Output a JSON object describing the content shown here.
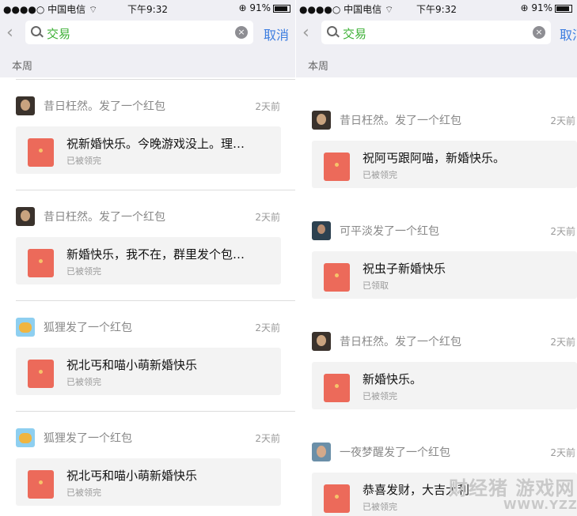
{
  "status_left": {
    "carrier": "●●●●○ 中国电信 ⌔",
    "time": "下午9:32",
    "battery": "⊕ 91%"
  },
  "status_right": {
    "carrier": "●●●●○ 中国电信 ⌔",
    "time": "下午9:32",
    "battery": "⊕ 91%"
  },
  "search": {
    "back_icon": "‹",
    "query": "交易",
    "clear_icon": "×",
    "cancel": "取消"
  },
  "section": "本周",
  "colors": {
    "accent": "#3c7de0",
    "query_green": "#3cb035",
    "envelope": "#ec6a5a",
    "bg_gray": "#efeff4"
  },
  "left_items": [
    {
      "name": "昔日枉然。发了一个红包",
      "date": "2天前",
      "wish": "祝新婚快乐。今晚游戏没上。理…",
      "status": "已被领完",
      "avatar": "man-avatar"
    },
    {
      "name": "昔日枉然。发了一个红包",
      "date": "2天前",
      "wish": "新婚快乐，我不在，群里发个包…",
      "status": "已被领完",
      "avatar": "man-avatar"
    },
    {
      "name": "狐狸发了一个红包",
      "date": "2天前",
      "wish": "祝北丐和喵小萌新婚快乐",
      "status": "已被领完",
      "avatar": "cartoon-avatar"
    },
    {
      "name": "狐狸发了一个红包",
      "date": "2天前",
      "wish": "祝北丐和喵小萌新婚快乐",
      "status": "已被领完",
      "avatar": "cartoon-avatar"
    }
  ],
  "right_items": [
    {
      "name": "昔日枉然。发了一个红包",
      "date": "2天前",
      "wish": "祝阿丐跟阿喵，新婚快乐。",
      "status": "已被领完",
      "avatar": "man-avatar"
    },
    {
      "name": "可平淡发了一个红包",
      "date": "2天前",
      "wish": "祝虫子新婚快乐",
      "status": "已领取",
      "avatar": "portrait-avatar"
    },
    {
      "name": "昔日枉然。发了一个红包",
      "date": "2天前",
      "wish": "新婚快乐。",
      "status": "已被领完",
      "avatar": "man-avatar"
    },
    {
      "name": "一夜梦醒发了一个红包",
      "date": "2天前",
      "wish": "恭喜发财，大吉大利",
      "status": "已被领完",
      "avatar": "photo-avatar"
    }
  ],
  "watermark": {
    "brand": "财经猪 游戏网",
    "url": "WWW.YZZ.CN"
  }
}
